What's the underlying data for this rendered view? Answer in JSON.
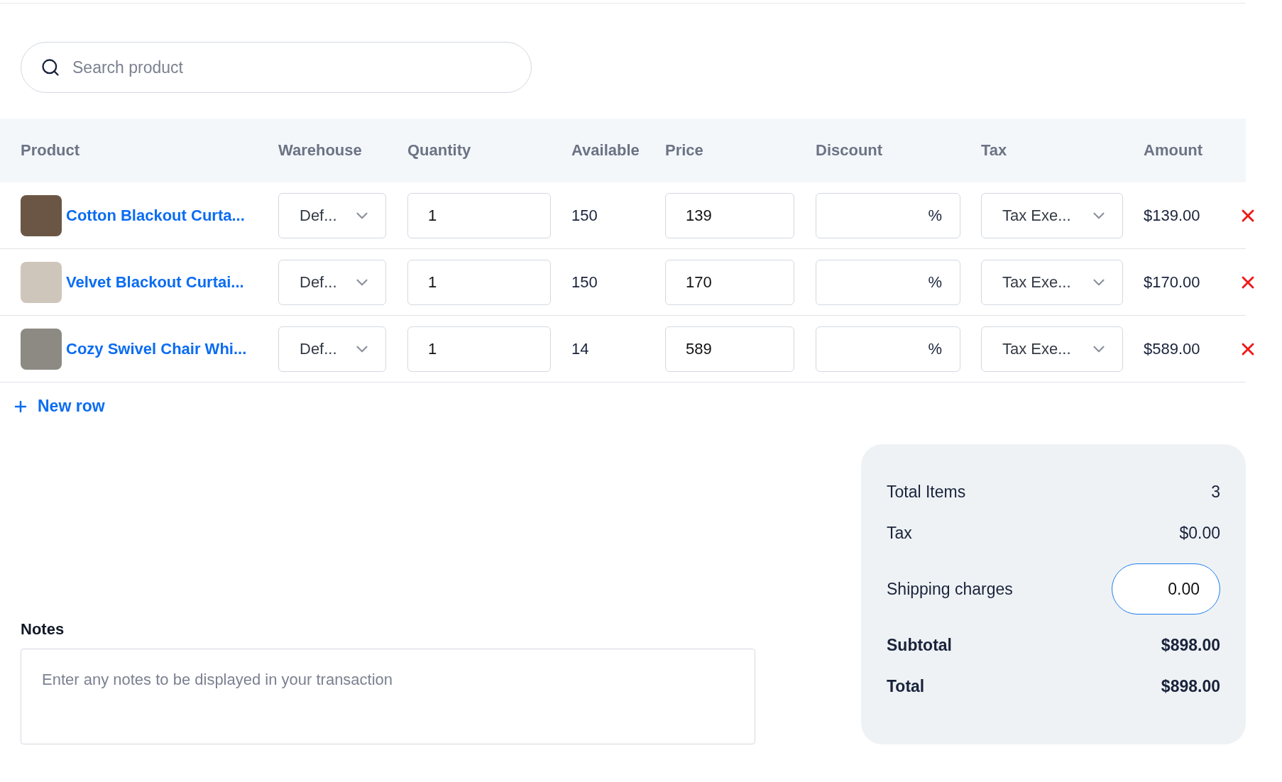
{
  "search": {
    "placeholder": "Search product"
  },
  "table": {
    "columns": [
      "Product",
      "Warehouse",
      "Quantity",
      "Available",
      "Price",
      "Discount",
      "Tax",
      "Amount"
    ],
    "rows": [
      {
        "product": "Cotton Blackout Curta...",
        "warehouse": "Def...",
        "quantity": "1",
        "available": "150",
        "price": "139",
        "discount_suffix": "%",
        "tax": "Tax Exe...",
        "amount": "$139.00"
      },
      {
        "product": "Velvet Blackout Curtai...",
        "warehouse": "Def...",
        "quantity": "1",
        "available": "150",
        "price": "170",
        "discount_suffix": "%",
        "tax": "Tax Exe...",
        "amount": "$170.00"
      },
      {
        "product": "Cozy Swivel Chair Whi...",
        "warehouse": "Def...",
        "quantity": "1",
        "available": "14",
        "price": "589",
        "discount_suffix": "%",
        "tax": "Tax Exe...",
        "amount": "$589.00"
      }
    ]
  },
  "new_row": {
    "label": "New row"
  },
  "notes": {
    "label": "Notes",
    "placeholder": "Enter any notes to be displayed in your transaction"
  },
  "summary": [
    {
      "kind": "text",
      "label": "Total Items",
      "value": "3"
    },
    {
      "kind": "text",
      "label": "Tax",
      "value": "$0.00"
    },
    {
      "kind": "input",
      "label": "Shipping charges",
      "value": "0.00"
    },
    {
      "kind": "bold",
      "label": "Subtotal",
      "value": "$898.00"
    },
    {
      "kind": "bold",
      "label": "Total",
      "value": "$898.00"
    }
  ]
}
